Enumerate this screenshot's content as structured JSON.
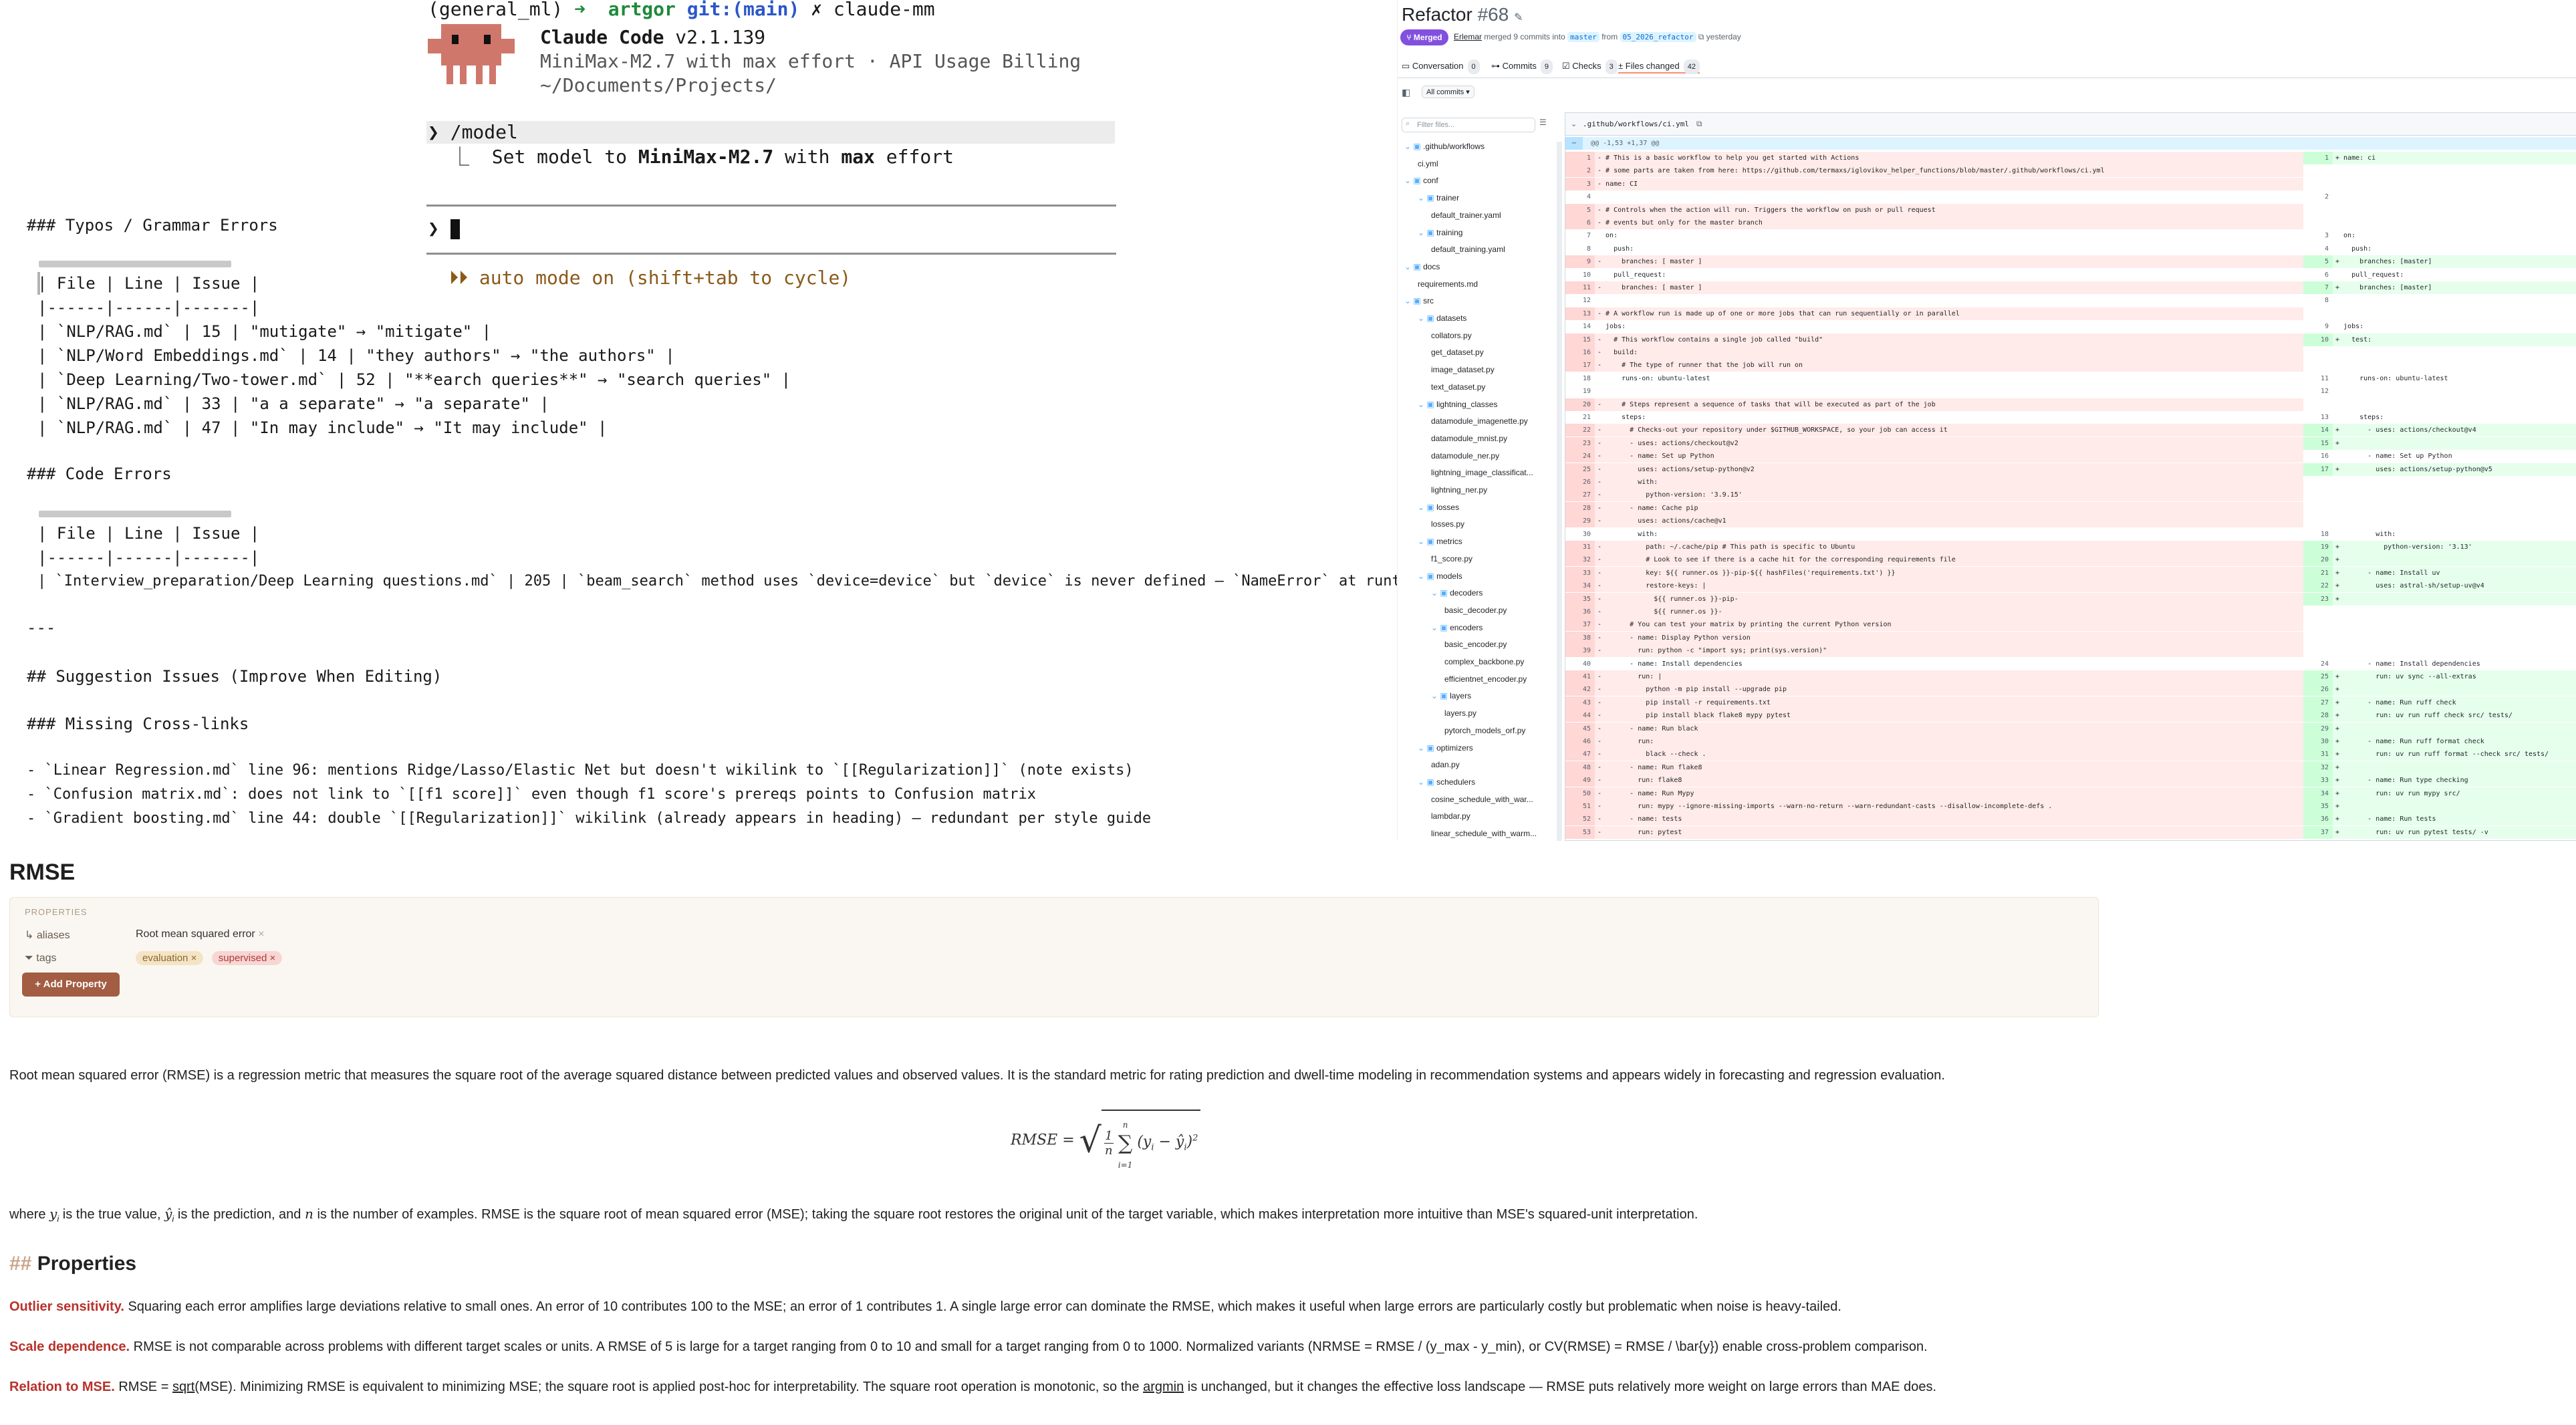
{
  "terminal": {
    "prompt_env": "(general_ml)",
    "prompt_arrow": "➜",
    "prompt_user": "artgor",
    "prompt_git": "git:(main)",
    "prompt_x": "✗",
    "prompt_cmd": "claude-mm",
    "app_name": "Claude Code",
    "app_version": "v2.1.139",
    "model_line": "MiniMax-M2.7 with max effort · API Usage Billing",
    "cwd": "~/Documents/Projects/",
    "command_prefix": "❯",
    "command": "/model",
    "response_prefix": "⎿",
    "response_a": "Set model to ",
    "response_model": "MiniMax-M2.7",
    "response_b": " with ",
    "response_effort": "max",
    "response_c": " effort",
    "input_prefix": "❯",
    "mode_line": "⏵⏵ auto mode on (shift+tab to cycle)",
    "typos_heading": "### Typos / Grammar Errors",
    "table_header": "| File | Line | Issue |",
    "table_sep": "|------|------|-------|",
    "typo_rows": [
      "| `NLP/RAG.md` | 15 | \"mutigate\" → \"mitigate\" |",
      "| `NLP/Word Embeddings.md` | 14 | \"they authors\" → \"the authors\" |",
      "| `Deep Learning/Two-tower.md` | 52 | \"**earch queries**\" → \"search queries\" |",
      "| `NLP/RAG.md` | 33 | \"a a separate\" → \"a separate\" |",
      "| `NLP/RAG.md` | 47 | \"In may include\" → \"It may include\" |"
    ],
    "code_heading": "### Code Errors",
    "code_row": "| `Interview_preparation/Deep Learning questions.md` | 205 | `beam_search` method uses `device=device` but `device` is never defined — `NameError` at runtime |",
    "hr": "---",
    "suggest_heading": "## Suggestion Issues (Improve When Editing)",
    "cross_heading": "### Missing Cross-links",
    "cross_items": [
      "- `Linear Regression.md` line 96: mentions Ridge/Lasso/Elastic Net but doesn't wikilink to `[[Regularization]]` (note exists)",
      "- `Confusion matrix.md`: does not link to `[[f1 score]]` even though f1 score's prereqs points to Confusion matrix",
      "- `Gradient boosting.md` line 44: double `[[Regularization]]` wikilink (already appears in heading) — redundant per style guide"
    ]
  },
  "pr": {
    "title": "Refactor",
    "number": "#68",
    "status": "Merged",
    "author": "Erlemar",
    "merge_text": "merged 9 commits into",
    "base_branch": "master",
    "from_word": "from",
    "head_branch": "05_2026_refactor",
    "when": "yesterday",
    "tabs": [
      {
        "label": "Conversation",
        "count": "0"
      },
      {
        "label": "Commits",
        "count": "9"
      },
      {
        "label": "Checks",
        "count": "3"
      },
      {
        "label": "Files changed",
        "count": "42"
      }
    ],
    "all_commits": "All commits",
    "filter_placeholder": "Filter files...",
    "file_path": ".github/workflows/ci.yml",
    "hunk_header": "@@ -1,53 +1,37 @@",
    "tree": [
      {
        "label": ".github/workflows",
        "folder": true,
        "level": 0
      },
      {
        "label": "ci.yml",
        "folder": false,
        "level": 1
      },
      {
        "label": "conf",
        "folder": true,
        "level": 0
      },
      {
        "label": "trainer",
        "folder": true,
        "level": 1
      },
      {
        "label": "default_trainer.yaml",
        "folder": false,
        "level": 2
      },
      {
        "label": "training",
        "folder": true,
        "level": 1
      },
      {
        "label": "default_training.yaml",
        "folder": false,
        "level": 2
      },
      {
        "label": "docs",
        "folder": true,
        "level": 0
      },
      {
        "label": "requirements.md",
        "folder": false,
        "level": 1
      },
      {
        "label": "src",
        "folder": true,
        "level": 0
      },
      {
        "label": "datasets",
        "folder": true,
        "level": 1
      },
      {
        "label": "collators.py",
        "folder": false,
        "level": 2
      },
      {
        "label": "get_dataset.py",
        "folder": false,
        "level": 2
      },
      {
        "label": "image_dataset.py",
        "folder": false,
        "level": 2
      },
      {
        "label": "text_dataset.py",
        "folder": false,
        "level": 2
      },
      {
        "label": "lightning_classes",
        "folder": true,
        "level": 1
      },
      {
        "label": "datamodule_imagenette.py",
        "folder": false,
        "level": 2
      },
      {
        "label": "datamodule_mnist.py",
        "folder": false,
        "level": 2
      },
      {
        "label": "datamodule_ner.py",
        "folder": false,
        "level": 2
      },
      {
        "label": "lightning_image_classificat...",
        "folder": false,
        "level": 2
      },
      {
        "label": "lightning_ner.py",
        "folder": false,
        "level": 2
      },
      {
        "label": "losses",
        "folder": true,
        "level": 1
      },
      {
        "label": "losses.py",
        "folder": false,
        "level": 2
      },
      {
        "label": "metrics",
        "folder": true,
        "level": 1
      },
      {
        "label": "f1_score.py",
        "folder": false,
        "level": 2
      },
      {
        "label": "models",
        "folder": true,
        "level": 1
      },
      {
        "label": "decoders",
        "folder": true,
        "level": 2
      },
      {
        "label": "basic_decoder.py",
        "folder": false,
        "level": 3
      },
      {
        "label": "encoders",
        "folder": true,
        "level": 2
      },
      {
        "label": "basic_encoder.py",
        "folder": false,
        "level": 3
      },
      {
        "label": "complex_backbone.py",
        "folder": false,
        "level": 3
      },
      {
        "label": "efficientnet_encoder.py",
        "folder": false,
        "level": 3
      },
      {
        "label": "layers",
        "folder": true,
        "level": 2
      },
      {
        "label": "layers.py",
        "folder": false,
        "level": 3
      },
      {
        "label": "pytorch_models_orf.py",
        "folder": false,
        "level": 3
      },
      {
        "label": "optimizers",
        "folder": true,
        "level": 1
      },
      {
        "label": "adan.py",
        "folder": false,
        "level": 2
      },
      {
        "label": "schedulers",
        "folder": true,
        "level": 1
      },
      {
        "label": "cosine_schedule_with_war...",
        "folder": false,
        "level": 2
      },
      {
        "label": "lambdar.py",
        "folder": false,
        "level": 2
      },
      {
        "label": "linear_schedule_with_warm...",
        "folder": false,
        "level": 2
      }
    ],
    "left_lines": [
      {
        "n": "1",
        "t": "del",
        "s": "- # This is a basic workflow to help you get started with Actions"
      },
      {
        "n": "2",
        "t": "del",
        "s": "- # some parts are taken from here: https://github.com/termaxs/iglovikov_helper_functions/blob/master/.github/workflows/ci.yml"
      },
      {
        "n": "3",
        "t": "del",
        "s": "- name: CI"
      },
      {
        "n": "4",
        "t": "ctx",
        "s": ""
      },
      {
        "n": "5",
        "t": "del",
        "s": "- # Controls when the action will run. Triggers the workflow on push or pull request"
      },
      {
        "n": "6",
        "t": "del",
        "s": "- # events but only for the master branch"
      },
      {
        "n": "7",
        "t": "ctx",
        "s": "  on:"
      },
      {
        "n": "8",
        "t": "ctx",
        "s": "    push:"
      },
      {
        "n": "9",
        "t": "del",
        "s": "-     branches: [ master ]"
      },
      {
        "n": "10",
        "t": "ctx",
        "s": "    pull_request:"
      },
      {
        "n": "11",
        "t": "del",
        "s": "-     branches: [ master ]"
      },
      {
        "n": "12",
        "t": "ctx",
        "s": ""
      },
      {
        "n": "13",
        "t": "del",
        "s": "- # A workflow run is made up of one or more jobs that can run sequentially or in parallel"
      },
      {
        "n": "14",
        "t": "ctx",
        "s": "  jobs:"
      },
      {
        "n": "15",
        "t": "del",
        "s": "-   # This workflow contains a single job called \"build\""
      },
      {
        "n": "16",
        "t": "del",
        "s": "-   build:"
      },
      {
        "n": "17",
        "t": "del",
        "s": "-     # The type of runner that the job will run on"
      },
      {
        "n": "18",
        "t": "ctx",
        "s": "      runs-on: ubuntu-latest"
      },
      {
        "n": "19",
        "t": "ctx",
        "s": ""
      },
      {
        "n": "20",
        "t": "del",
        "s": "-     # Steps represent a sequence of tasks that will be executed as part of the job"
      },
      {
        "n": "21",
        "t": "ctx",
        "s": "      steps:"
      },
      {
        "n": "22",
        "t": "del",
        "s": "-       # Checks-out your repository under $GITHUB_WORKSPACE, so your job can access it"
      },
      {
        "n": "23",
        "t": "del",
        "s": "-       - uses: actions/checkout@v2"
      },
      {
        "n": "24",
        "t": "del",
        "s": "-       - name: Set up Python"
      },
      {
        "n": "25",
        "t": "del",
        "s": "-         uses: actions/setup-python@v2"
      },
      {
        "n": "26",
        "t": "del",
        "s": "-         with:"
      },
      {
        "n": "27",
        "t": "del",
        "s": "-           python-version: '3.9.15'"
      },
      {
        "n": "28",
        "t": "del",
        "s": "-       - name: Cache pip"
      },
      {
        "n": "29",
        "t": "del",
        "s": "-         uses: actions/cache@v1"
      },
      {
        "n": "30",
        "t": "ctx",
        "s": "          with:"
      },
      {
        "n": "31",
        "t": "del",
        "s": "-           path: ~/.cache/pip # This path is specific to Ubuntu"
      },
      {
        "n": "32",
        "t": "del",
        "s": "-           # Look to see if there is a cache hit for the corresponding requirements file"
      },
      {
        "n": "33",
        "t": "del",
        "s": "-           key: ${{ runner.os }}-pip-${{ hashFiles('requirements.txt') }}"
      },
      {
        "n": "34",
        "t": "del",
        "s": "-           restore-keys: |"
      },
      {
        "n": "35",
        "t": "del",
        "s": "-             ${{ runner.os }}-pip-"
      },
      {
        "n": "36",
        "t": "del",
        "s": "-             ${{ runner.os }}-"
      },
      {
        "n": "37",
        "t": "del",
        "s": "-       # You can test your matrix by printing the current Python version"
      },
      {
        "n": "38",
        "t": "del",
        "s": "-       - name: Display Python version"
      },
      {
        "n": "39",
        "t": "del",
        "s": "-         run: python -c \"import sys; print(sys.version)\""
      },
      {
        "n": "40",
        "t": "ctx",
        "s": "        - name: Install dependencies"
      },
      {
        "n": "41",
        "t": "del",
        "s": "-         run: |"
      },
      {
        "n": "42",
        "t": "del",
        "s": "-           python -m pip install --upgrade pip"
      },
      {
        "n": "43",
        "t": "del",
        "s": "-           pip install -r requirements.txt"
      },
      {
        "n": "44",
        "t": "del",
        "s": "-           pip install black flake8 mypy pytest"
      },
      {
        "n": "45",
        "t": "del",
        "s": "-       - name: Run black"
      },
      {
        "n": "46",
        "t": "del",
        "s": "-         run:"
      },
      {
        "n": "47",
        "t": "del",
        "s": "-           black --check ."
      },
      {
        "n": "48",
        "t": "del",
        "s": "-       - name: Run flake8"
      },
      {
        "n": "49",
        "t": "del",
        "s": "-         run: flake8"
      },
      {
        "n": "50",
        "t": "del",
        "s": "-       - name: Run Mypy"
      },
      {
        "n": "51",
        "t": "del",
        "s": "-         run: mypy --ignore-missing-imports --warn-no-return --warn-redundant-casts --disallow-incomplete-defs ."
      },
      {
        "n": "52",
        "t": "del",
        "s": "-       - name: tests"
      },
      {
        "n": "53",
        "t": "del",
        "s": "-         run: pytest"
      }
    ],
    "right_lines": [
      {
        "row": 0,
        "n": "1",
        "t": "add",
        "s": "+ name: ci"
      },
      {
        "row": 3,
        "n": "2",
        "t": "ctx",
        "s": ""
      },
      {
        "row": 6,
        "n": "3",
        "t": "ctx",
        "s": "  on:"
      },
      {
        "row": 7,
        "n": "4",
        "t": "ctx",
        "s": "    push:"
      },
      {
        "row": 8,
        "n": "5",
        "t": "add",
        "s": "+     branches: [master]"
      },
      {
        "row": 9,
        "n": "6",
        "t": "ctx",
        "s": "    pull_request:"
      },
      {
        "row": 10,
        "n": "7",
        "t": "add",
        "s": "+     branches: [master]"
      },
      {
        "row": 11,
        "n": "8",
        "t": "ctx",
        "s": ""
      },
      {
        "row": 13,
        "n": "9",
        "t": "ctx",
        "s": "  jobs:"
      },
      {
        "row": 14,
        "n": "10",
        "t": "add",
        "s": "+   test:"
      },
      {
        "row": 17,
        "n": "11",
        "t": "ctx",
        "s": "      runs-on: ubuntu-latest"
      },
      {
        "row": 18,
        "n": "12",
        "t": "ctx",
        "s": ""
      },
      {
        "row": 20,
        "n": "13",
        "t": "ctx",
        "s": "      steps:"
      },
      {
        "row": 21,
        "n": "14",
        "t": "add",
        "s": "+       - uses: actions/checkout@v4"
      },
      {
        "row": 22,
        "n": "15",
        "t": "add",
        "s": "+"
      },
      {
        "row": 23,
        "n": "16",
        "t": "ctx",
        "s": "        - name: Set up Python"
      },
      {
        "row": 24,
        "n": "17",
        "t": "add",
        "s": "+         uses: actions/setup-python@v5"
      },
      {
        "row": 29,
        "n": "18",
        "t": "ctx",
        "s": "          with:"
      },
      {
        "row": 30,
        "n": "19",
        "t": "add",
        "s": "+           python-version: '3.13'"
      },
      {
        "row": 31,
        "n": "20",
        "t": "add",
        "s": "+"
      },
      {
        "row": 32,
        "n": "21",
        "t": "add",
        "s": "+       - name: Install uv"
      },
      {
        "row": 33,
        "n": "22",
        "t": "add",
        "s": "+         uses: astral-sh/setup-uv@v4"
      },
      {
        "row": 34,
        "n": "23",
        "t": "add",
        "s": "+"
      },
      {
        "row": 39,
        "n": "24",
        "t": "ctx",
        "s": "        - name: Install dependencies"
      },
      {
        "row": 40,
        "n": "25",
        "t": "add",
        "s": "+         run: uv sync --all-extras"
      },
      {
        "row": 41,
        "n": "26",
        "t": "add",
        "s": "+"
      },
      {
        "row": 42,
        "n": "27",
        "t": "add",
        "s": "+       - name: Run ruff check"
      },
      {
        "row": 43,
        "n": "28",
        "t": "add",
        "s": "+         run: uv run ruff check src/ tests/"
      },
      {
        "row": 44,
        "n": "29",
        "t": "add",
        "s": "+"
      },
      {
        "row": 45,
        "n": "30",
        "t": "add",
        "s": "+       - name: Run ruff format check"
      },
      {
        "row": 46,
        "n": "31",
        "t": "add",
        "s": "+         run: uv run ruff format --check src/ tests/"
      },
      {
        "row": 47,
        "n": "32",
        "t": "add",
        "s": "+"
      },
      {
        "row": 48,
        "n": "33",
        "t": "add",
        "s": "+       - name: Run type checking"
      },
      {
        "row": 49,
        "n": "34",
        "t": "add",
        "s": "+         run: uv run mypy src/"
      },
      {
        "row": 50,
        "n": "35",
        "t": "add",
        "s": "+"
      },
      {
        "row": 51,
        "n": "36",
        "t": "add",
        "s": "+       - name: Run tests"
      },
      {
        "row": 52,
        "n": "37",
        "t": "add",
        "s": "+         run: uv run pytest tests/ -v"
      }
    ]
  },
  "note": {
    "title": "RMSE",
    "properties_label": "PROPERTIES",
    "aliases_label": "aliases",
    "aliases_value": "Root mean squared error",
    "tags_label": "tags",
    "tags": [
      "evaluation",
      "supervised"
    ],
    "add_property": "+ Add Property",
    "intro": "Root mean squared error (RMSE) is a regression metric that measures the square root of the average squared distance between predicted values and observed values. It is the standard metric for rating prediction and dwell-time modeling in recommendation systems and appears widely in forecasting and regression evaluation.",
    "formula_lhs": "RMSE =",
    "formula_frac_num": "1",
    "formula_frac_den": "n",
    "formula_sum_top": "n",
    "formula_sum_bot": "i=1",
    "formula_term": "(y",
    "formula_term2": " − ŷ",
    "formula_term3": ")",
    "formula_sub": "i",
    "formula_sup": "2",
    "def_a": "where ",
    "def_yi": "y",
    "def_b": " is the true value, ",
    "def_yhat": "ŷ",
    "def_c": " is the prediction, and ",
    "def_n": "n",
    "def_d": " is the number of examples. RMSE is the square root of mean squared error (MSE); taking the square root restores the original unit of the target variable, which makes interpretation more intuitive than MSE's squared-unit interpretation.",
    "h2_hash": "##",
    "h2_title": "Properties",
    "p1_term": "Outlier sensitivity.",
    "p1_text": " Squaring each error amplifies large deviations relative to small ones. An error of 10 contributes 100 to the MSE; an error of 1 contributes 1. A single large error can dominate the RMSE, which makes it useful when large errors are particularly costly but problematic when noise is heavy-tailed.",
    "p2_term": "Scale dependence.",
    "p2_text": " RMSE is not comparable across problems with different target scales or units. A RMSE of 5 is large for a target ranging from 0 to 10 and small for a target ranging from 0 to 1000. Normalized variants (NRMSE = RMSE / (y_max - y_min), or CV(RMSE) = RMSE / \\bar{y}) enable cross-problem comparison.",
    "p3_term": "Relation to MSE.",
    "p3_text_a": " RMSE = ",
    "p3_sqrt": "sqrt",
    "p3_text_b": "(MSE). Minimizing RMSE is equivalent to minimizing MSE; the square root is applied post-hoc for interpretability. The square root operation is monotonic, so the ",
    "p3_argmin": "argmin",
    "p3_text_c": " is unchanged, but it changes the effective loss landscape — RMSE puts relatively more weight on large errors than MAE does."
  }
}
